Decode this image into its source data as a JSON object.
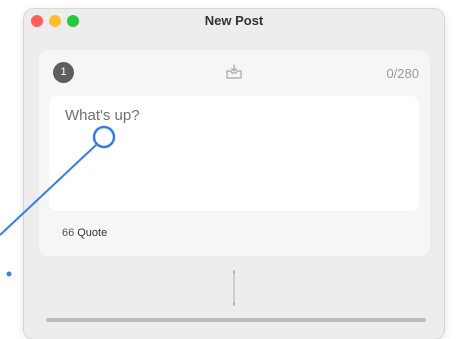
{
  "window": {
    "title": "New Post"
  },
  "composer": {
    "post_number": "1",
    "char_count": "0/280",
    "placeholder": "What's up?",
    "quote_label": "Quote",
    "quote_icon_glyph": "66"
  },
  "colors": {
    "window_bg": "#ededed",
    "card_bg": "#f6f6f6",
    "badge_bg": "#5e5e5e",
    "pointer_blue": "#3a7fdf"
  }
}
